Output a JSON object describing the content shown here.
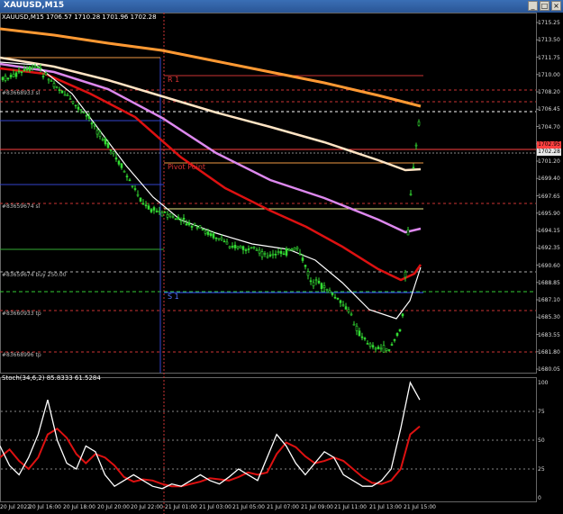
{
  "window": {
    "title": "XAUUSD,M15"
  },
  "chart": {
    "info": "XAUUSD,M15  1706.57 1710.28 1701.96 1702.28",
    "price_axis": [
      "1715.25",
      "1713.50",
      "1711.75",
      "1710.00",
      "1708.20",
      "1706.45",
      "1704.70",
      "1702.95",
      "1701.20",
      "1699.40",
      "1697.65",
      "1695.90",
      "1694.15",
      "1692.35",
      "1690.60",
      "1688.85",
      "1687.10",
      "1685.30",
      "1683.55",
      "1681.80",
      "1680.05"
    ],
    "current_price": {
      "text": "1702.28",
      "color": "#e8e8e8"
    },
    "ask_price": {
      "text": "1702.95",
      "color": "#ff4040"
    },
    "time_axis": [
      "20 Jul 2022",
      "20 Jul 16:00",
      "20 Jul 18:00",
      "20 Jul 20:00",
      "20 Jul 22:00",
      "21 Jul 01:00",
      "21 Jul 03:00",
      "21 Jul 05:00",
      "21 Jul 07:00",
      "21 Jul 09:00",
      "21 Jul 11:00",
      "21 Jul 13:00",
      "21 Jul 15:00"
    ],
    "order_labels": [
      "#83659674 sl",
      "#83659674 buy 250.00",
      "#83660933 tp",
      "#83668996 tp",
      "#83668933 sl"
    ],
    "pivot_labels": {
      "r1": "R 1",
      "pivot": "Pivot Point",
      "s1": "S 1"
    },
    "colors": {
      "orange_ma": "#ff9933",
      "white_ma": "#ffe4c4",
      "violet_ma": "#dd88ee",
      "red_ma": "#dd1111",
      "candle": "#33dd33"
    }
  },
  "stoch": {
    "info": "Stoch(34,6,2) 85.8333 61.5284",
    "levels": [
      "100",
      "75",
      "50",
      "25",
      "0"
    ],
    "main_color": "#ffffff",
    "signal_color": "#dd1111"
  }
}
